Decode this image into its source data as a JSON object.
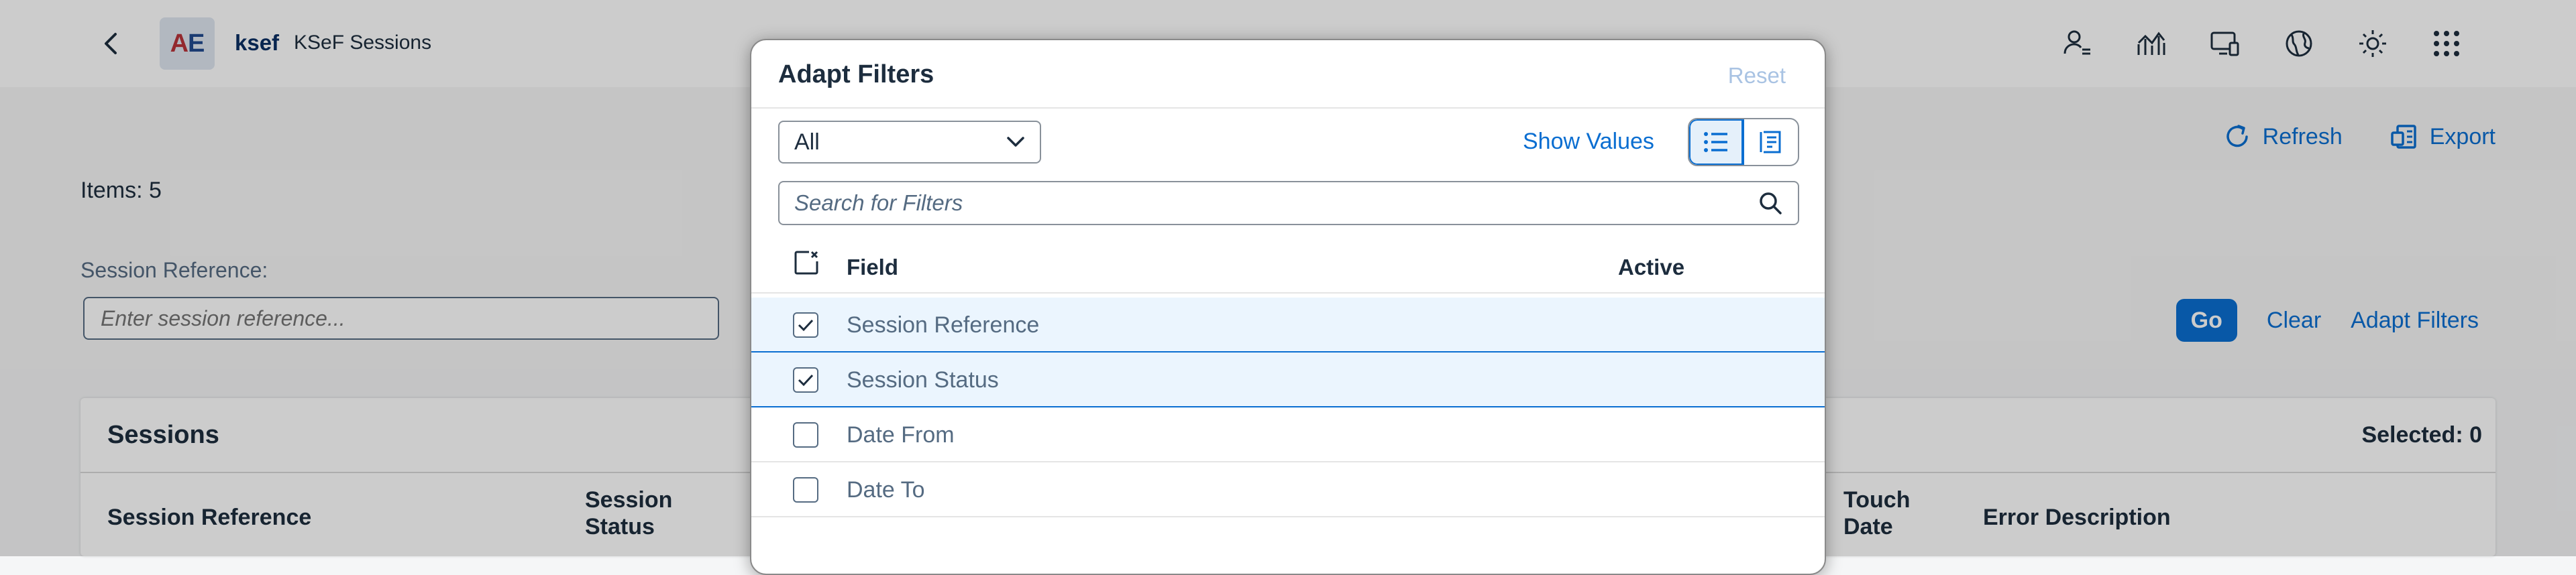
{
  "shell": {
    "app_logo_text_a": "A",
    "app_logo_text_e": "E",
    "app_title": "ksef",
    "app_subtitle": "KSeF Sessions",
    "icons": [
      "user-list-icon",
      "analytics-icon",
      "display-device-icon",
      "globe-icon",
      "theme-sun-icon",
      "apps-grid-icon"
    ]
  },
  "page": {
    "items_count": "Items: 5",
    "refresh_label": "Refresh",
    "export_label": "Export",
    "filter_label": "Session Reference:",
    "filter_placeholder": "Enter session reference...",
    "go_label": "Go",
    "clear_label": "Clear",
    "adapt_filters_label": "Adapt Filters"
  },
  "table": {
    "title": "Sessions",
    "selected": "Selected: 0",
    "columns": [
      {
        "label": "Session Reference"
      },
      {
        "label": "Session\nStatus"
      },
      {
        "label": "Touch\nDate"
      },
      {
        "label": "Error Description"
      }
    ]
  },
  "dialog": {
    "title": "Adapt Filters",
    "reset_label": "Reset",
    "select_value": "All",
    "show_values_label": "Show Values",
    "search_placeholder": "Search for Filters",
    "col_field": "Field",
    "col_active": "Active",
    "rows": [
      {
        "label": "Session Reference",
        "checked": true
      },
      {
        "label": "Session Status",
        "checked": true
      },
      {
        "label": "Date From",
        "checked": false
      },
      {
        "label": "Date To",
        "checked": false
      }
    ]
  },
  "colors": {
    "accent": "#0a6ed1",
    "selected_row": "#ebf5fe",
    "title_dark": "#0a2f63"
  }
}
